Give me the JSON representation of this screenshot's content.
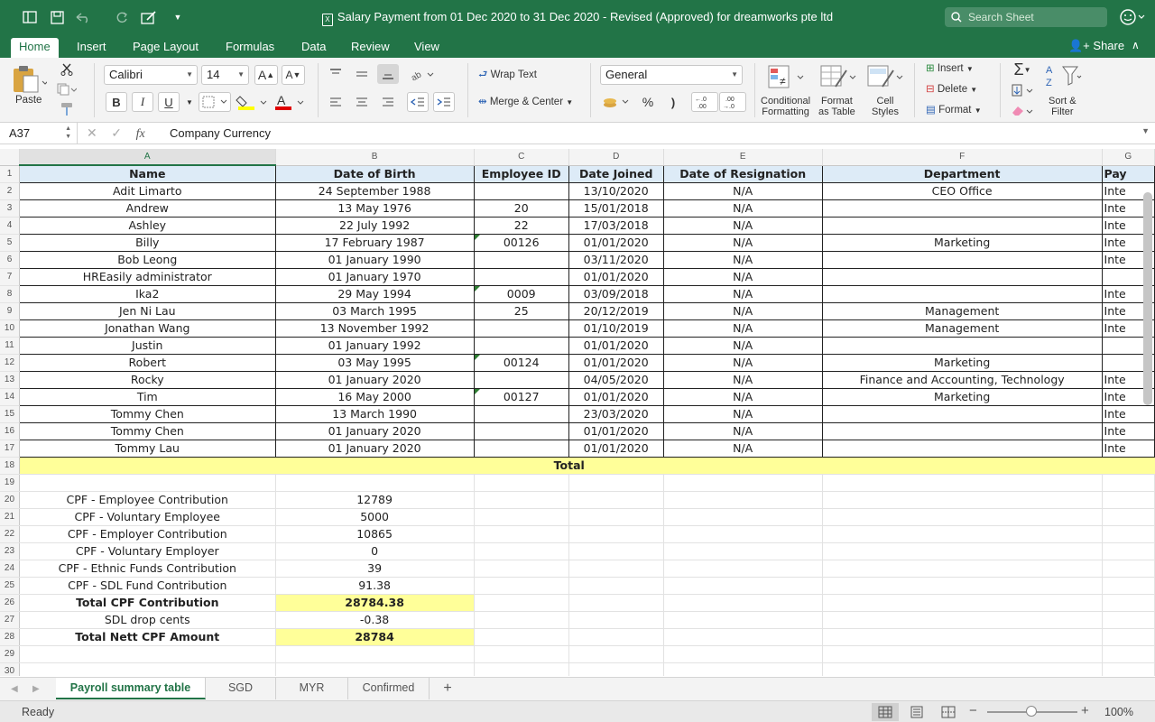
{
  "window": {
    "title": "Salary Payment from 01 Dec 2020 to 31 Dec 2020 - Revised  (Approved) for dreamworks pte ltd",
    "search_placeholder": "Search Sheet"
  },
  "ribbon_tabs": [
    "Home",
    "Insert",
    "Page Layout",
    "Formulas",
    "Data",
    "Review",
    "View"
  ],
  "share_label": "Share",
  "ribbon": {
    "paste_label": "Paste",
    "font_name": "Calibri",
    "font_size": "14",
    "bold": "B",
    "italic": "I",
    "underline": "U",
    "wrap_text": "Wrap Text",
    "merge_center": "Merge & Center",
    "number_format": "General",
    "percent": "%",
    "comma": ")",
    "inc_decimal": "←.0 .00",
    "dec_decimal": ".00 →.0",
    "conditional_formatting": [
      "Conditional",
      "Formatting"
    ],
    "format_as_table": [
      "Format",
      "as Table"
    ],
    "cell_styles": [
      "Cell",
      "Styles"
    ],
    "insert": "Insert",
    "delete": "Delete",
    "format": "Format",
    "sort_filter": [
      "Sort &",
      "Filter"
    ]
  },
  "formula_bar": {
    "name_box": "A37",
    "formula": "Company Currency"
  },
  "columns": [
    "A",
    "B",
    "C",
    "D",
    "E",
    "F",
    "G"
  ],
  "header_row": [
    "Name",
    "Date of Birth",
    "Employee ID",
    "Date Joined",
    "Date of Resignation",
    "Department",
    "Pay"
  ],
  "employees": [
    [
      "Adit Limarto",
      "24 September 1988",
      "",
      "13/10/2020",
      "N/A",
      "CEO Office",
      "Inte"
    ],
    [
      "Andrew",
      "13 May 1976",
      "20",
      "15/01/2018",
      "N/A",
      "",
      "Inte"
    ],
    [
      "Ashley",
      "22 July 1992",
      "22",
      "17/03/2018",
      "N/A",
      "",
      "Inte"
    ],
    [
      "Billy",
      "17 February 1987",
      "00126",
      "01/01/2020",
      "N/A",
      "Marketing",
      "Inte"
    ],
    [
      "Bob Leong",
      "01 January 1990",
      "",
      "03/11/2020",
      "N/A",
      "",
      "Inte"
    ],
    [
      "HREasily administrator",
      "01 January 1970",
      "",
      "01/01/2020",
      "N/A",
      "",
      ""
    ],
    [
      "Ika2",
      "29 May 1994",
      "0009",
      "03/09/2018",
      "N/A",
      "",
      "Inte"
    ],
    [
      "Jen Ni Lau",
      "03 March 1995",
      "25",
      "20/12/2019",
      "N/A",
      "Management",
      "Inte"
    ],
    [
      "Jonathan Wang",
      "13 November 1992",
      "",
      "01/10/2019",
      "N/A",
      "Management",
      "Inte"
    ],
    [
      "Justin",
      "01 January 1992",
      "",
      "01/01/2020",
      "N/A",
      "",
      ""
    ],
    [
      "Robert",
      "03 May 1995",
      "00124",
      "01/01/2020",
      "N/A",
      "Marketing",
      ""
    ],
    [
      "Rocky",
      "01 January 2020",
      "",
      "04/05/2020",
      "N/A",
      "Finance and Accounting, Technology",
      "Inte"
    ],
    [
      "Tim",
      "16 May 2000",
      "00127",
      "01/01/2020",
      "N/A",
      "Marketing",
      "Inte"
    ],
    [
      "Tommy Chen",
      "13 March 1990",
      "",
      "23/03/2020",
      "N/A",
      "",
      "Inte"
    ],
    [
      "Tommy Chen",
      "01 January 2020",
      "",
      "01/01/2020",
      "N/A",
      "",
      "Inte"
    ],
    [
      "Tommy Lau",
      "01 January 2020",
      "",
      "01/01/2020",
      "N/A",
      "",
      "Inte"
    ]
  ],
  "total_label": "Total",
  "cpf": [
    {
      "label": "CPF - Employee Contribution",
      "value": "12789",
      "bold": false,
      "highlight": false
    },
    {
      "label": "CPF - Voluntary Employee",
      "value": "5000",
      "bold": false,
      "highlight": false
    },
    {
      "label": "CPF - Employer Contribution",
      "value": "10865",
      "bold": false,
      "highlight": false
    },
    {
      "label": "CPF - Voluntary Employer",
      "value": "0",
      "bold": false,
      "highlight": false
    },
    {
      "label": "CPF - Ethnic Funds Contribution",
      "value": "39",
      "bold": false,
      "highlight": false
    },
    {
      "label": "CPF - SDL Fund Contribution",
      "value": "91.38",
      "bold": false,
      "highlight": false
    },
    {
      "label": "Total CPF Contribution",
      "value": "28784.38",
      "bold": true,
      "highlight": true
    },
    {
      "label": "SDL drop cents",
      "value": "-0.38",
      "bold": false,
      "highlight": false
    },
    {
      "label": "Total Nett CPF Amount",
      "value": "28784",
      "bold": true,
      "highlight": true
    }
  ],
  "sheet_tabs": [
    "Payroll summary table",
    "SGD",
    "MYR",
    "Confirmed"
  ],
  "status": {
    "text": "Ready",
    "zoom": "100%"
  },
  "colors": {
    "excel_green": "#227447",
    "header_fill": "#ddebf7",
    "highlight_yellow": "#ffff99"
  }
}
